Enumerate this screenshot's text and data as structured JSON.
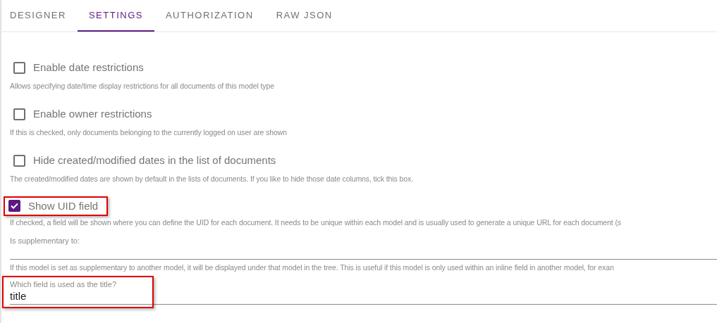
{
  "tabs": [
    {
      "label": "DESIGNER",
      "selected": false
    },
    {
      "label": "SETTINGS",
      "selected": true
    },
    {
      "label": "AUTHORIZATION",
      "selected": false
    },
    {
      "label": "RAW JSON",
      "selected": false
    }
  ],
  "options": [
    {
      "label": "Enable date restrictions",
      "checked": false,
      "highlighted": false,
      "description": "Allows specifying date/time display restrictions for all documents of this model type"
    },
    {
      "label": "Enable owner restrictions",
      "checked": false,
      "highlighted": false,
      "description": "If this is checked, only documents belonging to the currently logged on user are shown"
    },
    {
      "label": "Hide created/modified dates in the list of documents",
      "checked": false,
      "highlighted": false,
      "description": "The created/modified dates are shown by default in the lists of documents. If you like to hide those date columns, tick this box."
    },
    {
      "label": "Show UID field",
      "checked": true,
      "highlighted": true,
      "description": "If checked, a field will be shown where you can define the UID for each document. It needs to be unique within each model and is usually used to generate a unique URL for each document (s"
    }
  ],
  "fields": [
    {
      "label": "Is supplementary to:",
      "highlighted": false,
      "helper": "If this model is set as supplementary to another model, it will be displayed under that model in the tree. This is useful if this model is only used within an inline field in another model, for exan"
    },
    {
      "label": "Which field is used as the title?",
      "value": "title",
      "highlighted": true
    }
  ]
}
